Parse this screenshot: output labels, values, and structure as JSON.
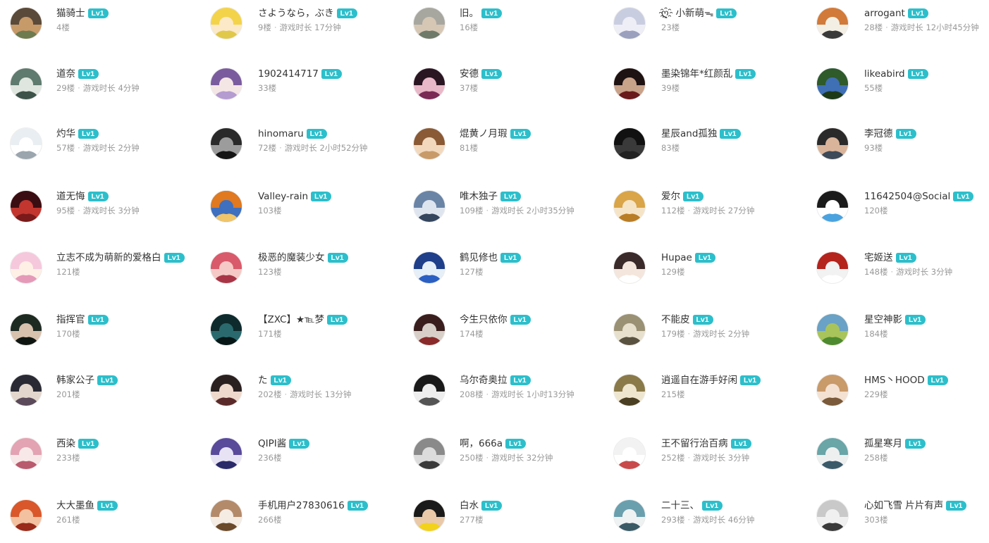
{
  "level_badge_color": "#2cbfcb",
  "users": [
    {
      "name": "猫骑士",
      "level": "Lv1",
      "floor": "4楼",
      "playtime": "",
      "colors": [
        "#5a4a3a",
        "#c79a6a",
        "#6e7b4f"
      ]
    },
    {
      "name": "さようなら，ぶき",
      "level": "Lv1",
      "floor": "9楼",
      "playtime": "游戏时长 17分钟",
      "colors": [
        "#f3d34a",
        "#fbe9c7",
        "#e0c84a"
      ]
    },
    {
      "name": "旧。",
      "level": "Lv1",
      "floor": "16楼",
      "playtime": "",
      "colors": [
        "#a7a7a0",
        "#d6c7b5",
        "#6f7a68"
      ]
    },
    {
      "name": "ღ҈ 小新萌ᯓ",
      "level": "Lv1",
      "floor": "23楼",
      "playtime": "",
      "colors": [
        "#c9cde0",
        "#eeeeF6",
        "#9aa0bd"
      ]
    },
    {
      "name": "arrogant",
      "level": "Lv1",
      "floor": "28楼",
      "playtime": "游戏时长 12小时45分钟",
      "colors": [
        "#d17a3a",
        "#f4efe4",
        "#3a3a3a"
      ]
    },
    {
      "name": "道奈",
      "level": "Lv1",
      "floor": "29楼",
      "playtime": "游戏时长 4分钟",
      "colors": [
        "#5f7a6e",
        "#dfe6df",
        "#3d5248"
      ]
    },
    {
      "name": "1902414717",
      "level": "Lv1",
      "floor": "33楼",
      "playtime": "",
      "colors": [
        "#7a5c9e",
        "#f5e6e6",
        "#b49bd0"
      ]
    },
    {
      "name": "安德",
      "level": "Lv1",
      "floor": "37楼",
      "playtime": "",
      "colors": [
        "#2a1622",
        "#e9b8c8",
        "#7a2a55"
      ]
    },
    {
      "name": "墨染锦年*红颜乱",
      "level": "Lv1",
      "floor": "39楼",
      "playtime": "",
      "colors": [
        "#1e1212",
        "#c9a28a",
        "#6a1a1a"
      ]
    },
    {
      "name": "likeabird",
      "level": "Lv1",
      "floor": "55楼",
      "playtime": "",
      "colors": [
        "#2f5a2a",
        "#3f6fb5",
        "#1d3a17"
      ]
    },
    {
      "name": "灼华",
      "level": "Lv1",
      "floor": "57楼",
      "playtime": "游戏时长 2分钟",
      "colors": [
        "#e9eef2",
        "#ffffff",
        "#9aa5ad"
      ]
    },
    {
      "name": "hinomaru",
      "level": "Lv1",
      "floor": "72楼",
      "playtime": "游戏时长 2小时52分钟",
      "colors": [
        "#2a2a2a",
        "#9c9c9c",
        "#151515"
      ]
    },
    {
      "name": "焜黄ノ月瑕",
      "level": "Lv1",
      "floor": "81楼",
      "playtime": "",
      "colors": [
        "#8a5a36",
        "#f2d9be",
        "#c89a6a"
      ]
    },
    {
      "name": "星辰and孤独",
      "level": "Lv1",
      "floor": "83楼",
      "playtime": "",
      "colors": [
        "#111111",
        "#3a3a3a",
        "#222222"
      ]
    },
    {
      "name": "李冠德",
      "level": "Lv1",
      "floor": "93楼",
      "playtime": "",
      "colors": [
        "#2a2a2a",
        "#d9b49a",
        "#3c4a5a"
      ]
    },
    {
      "name": "道无悔",
      "level": "Lv1",
      "floor": "95楼",
      "playtime": "游戏时长 3分钟",
      "colors": [
        "#3a0d12",
        "#c2362f",
        "#7a1a1a"
      ]
    },
    {
      "name": "Valley-rain",
      "level": "Lv1",
      "floor": "103楼",
      "playtime": "",
      "colors": [
        "#e0791f",
        "#3f6fbf",
        "#f1c56a"
      ]
    },
    {
      "name": "唯木独子",
      "level": "Lv1",
      "floor": "109楼",
      "playtime": "游戏时长 2小时35分钟",
      "colors": [
        "#6a84a6",
        "#dfe5ef",
        "#34455e"
      ]
    },
    {
      "name": "爱尔",
      "level": "Lv1",
      "floor": "112楼",
      "playtime": "游戏时长 27分钟",
      "colors": [
        "#d9a548",
        "#f6e4c6",
        "#b97d25"
      ]
    },
    {
      "name": "11642504@Social",
      "level": "Lv1",
      "floor": "120楼",
      "playtime": "",
      "colors": [
        "#1b1b1b",
        "#ffffff",
        "#4aa3df"
      ]
    },
    {
      "name": "立志不成为萌新的爱格白",
      "level": "Lv1",
      "floor": "121楼",
      "playtime": "",
      "colors": [
        "#f6c8dc",
        "#fff0e6",
        "#e59ab8"
      ]
    },
    {
      "name": "极恶的魔装少女",
      "level": "Lv1",
      "floor": "123楼",
      "playtime": "",
      "colors": [
        "#d95a6a",
        "#f5c9c6",
        "#a83545"
      ]
    },
    {
      "name": "鹤见修也",
      "level": "Lv1",
      "floor": "127楼",
      "playtime": "",
      "colors": [
        "#1f3f8a",
        "#e6eef8",
        "#2b5fc2"
      ]
    },
    {
      "name": "Hupae",
      "level": "Lv1",
      "floor": "129楼",
      "playtime": "",
      "colors": [
        "#3a2a2a",
        "#f4e6dc",
        "#ffffff"
      ]
    },
    {
      "name": "宅姬送",
      "level": "Lv1",
      "floor": "148楼",
      "playtime": "游戏时长 3分钟",
      "colors": [
        "#b5231d",
        "#f2f2f2",
        "#ffffff"
      ]
    },
    {
      "name": "指挥官",
      "level": "Lv1",
      "floor": "170楼",
      "playtime": "",
      "colors": [
        "#1d2a22",
        "#d8c2ad",
        "#0f1612"
      ]
    },
    {
      "name": "【ZXC】★℡梦",
      "level": "Lv1",
      "floor": "171楼",
      "playtime": "",
      "colors": [
        "#0e2a2c",
        "#2a6a6e",
        "#071617"
      ]
    },
    {
      "name": "今生只依你",
      "level": "Lv1",
      "floor": "174楼",
      "playtime": "",
      "colors": [
        "#3a1e1e",
        "#d9cfc9",
        "#8a2a2a"
      ]
    },
    {
      "name": "不能皮",
      "level": "Lv1",
      "floor": "179楼",
      "playtime": "游戏时长 2分钟",
      "colors": [
        "#9a9074",
        "#e7e0cd",
        "#5a5240"
      ]
    },
    {
      "name": "星空神影",
      "level": "Lv1",
      "floor": "184楼",
      "playtime": "",
      "colors": [
        "#6aa1c7",
        "#a9c45a",
        "#4e8a2f"
      ]
    },
    {
      "name": "韩家公子",
      "level": "Lv1",
      "floor": "201楼",
      "playtime": "",
      "colors": [
        "#2a2a35",
        "#e3d6cc",
        "#5a4a5a"
      ]
    },
    {
      "name": "た",
      "level": "Lv1",
      "floor": "202楼",
      "playtime": "游戏时长 13分钟",
      "colors": [
        "#2a2020",
        "#efd9cc",
        "#5a2a2a"
      ]
    },
    {
      "name": "乌尔奇奥拉",
      "level": "Lv1",
      "floor": "208楼",
      "playtime": "游戏时长 1小时13分钟",
      "colors": [
        "#1a1a1a",
        "#eeeeee",
        "#555555"
      ]
    },
    {
      "name": "逍遥自在游手好闲",
      "level": "Lv1",
      "floor": "215楼",
      "playtime": "",
      "colors": [
        "#8a7a4a",
        "#efe6cf",
        "#4a3f22"
      ]
    },
    {
      "name": "HMS丶HOOD",
      "level": "Lv1",
      "floor": "229楼",
      "playtime": "",
      "colors": [
        "#c99a6a",
        "#f4e1d1",
        "#7a5a3a"
      ]
    },
    {
      "name": "西染",
      "level": "Lv1",
      "floor": "233楼",
      "playtime": "",
      "colors": [
        "#e3a3b2",
        "#f8e8e8",
        "#b95a6e"
      ]
    },
    {
      "name": "QIPI酱",
      "level": "Lv1",
      "floor": "236楼",
      "playtime": "",
      "colors": [
        "#5a4a9a",
        "#e7e3f5",
        "#2a2a6a"
      ]
    },
    {
      "name": "啊，666a",
      "level": "Lv1",
      "floor": "250楼",
      "playtime": "游戏时长 32分钟",
      "colors": [
        "#8a8a8a",
        "#dcdcdc",
        "#3a3a3a"
      ]
    },
    {
      "name": "王不留行治百病",
      "level": "Lv1",
      "floor": "252楼",
      "playtime": "游戏时长 3分钟",
      "colors": [
        "#f2f2f2",
        "#ffffff",
        "#c94a4a"
      ]
    },
    {
      "name": "孤星寒月",
      "level": "Lv1",
      "floor": "258楼",
      "playtime": "",
      "colors": [
        "#6aa5a8",
        "#eef0f0",
        "#3a5a6a"
      ]
    },
    {
      "name": "大大墨鱼",
      "level": "Lv1",
      "floor": "261楼",
      "playtime": "",
      "colors": [
        "#d9572a",
        "#f3c1a0",
        "#9a2a1a"
      ]
    },
    {
      "name": "手机用户27830616",
      "level": "Lv1",
      "floor": "266楼",
      "playtime": "",
      "colors": [
        "#b38a6a",
        "#f5ece4",
        "#6a4a2a"
      ]
    },
    {
      "name": "白水",
      "level": "Lv1",
      "floor": "277楼",
      "playtime": "",
      "colors": [
        "#1a1a1a",
        "#e9c9a8",
        "#f2d21a"
      ]
    },
    {
      "name": "二十三、",
      "level": "Lv1",
      "floor": "293楼",
      "playtime": "游戏时长 46分钟",
      "colors": [
        "#6a9fae",
        "#eef2f3",
        "#3a5a66"
      ]
    },
    {
      "name": "心如飞雪 片片有声",
      "level": "Lv1",
      "floor": "303楼",
      "playtime": "",
      "colors": [
        "#c9c9c9",
        "#f0f0f0",
        "#3a3a3a"
      ]
    }
  ]
}
